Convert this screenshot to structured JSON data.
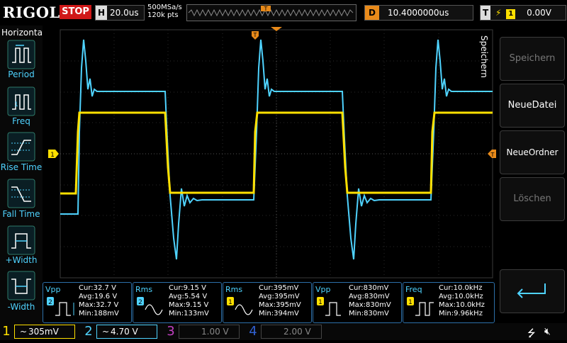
{
  "header": {
    "brand": "RIGOL",
    "run_state": "STOP",
    "timebase_key": "H",
    "timebase": "20.0us",
    "sample_rate": "500MSa/s",
    "memory_depth": "120k pts",
    "delay_key": "D",
    "delay": "10.4000000us",
    "trigger_key": "T",
    "trigger_source": "1",
    "trigger_level": "0.00V"
  },
  "left_menu": {
    "title": "Horizontal",
    "items": [
      {
        "label": "Period"
      },
      {
        "label": "Freq"
      },
      {
        "label": "Rise Time"
      },
      {
        "label": "Fall Time"
      },
      {
        "label": "+Width"
      },
      {
        "label": "-Width"
      }
    ]
  },
  "right_menu": {
    "title": "Speichern",
    "items": [
      {
        "label": "Speichern",
        "enabled": false
      },
      {
        "label": "NeueDatei",
        "enabled": true
      },
      {
        "label": "NeueOrdner",
        "enabled": true
      },
      {
        "label": "Löschen",
        "enabled": false
      }
    ],
    "back_icon": "return-arrow-icon"
  },
  "markers": {
    "trigger_pos": "T",
    "ch1_level": "1",
    "trig_level_arrow": "T"
  },
  "measurements": [
    {
      "name": "Vpp",
      "channel": "2",
      "cur": "Cur:32.7 V",
      "avg": "Avg:19.6 V",
      "max": "Max:32.7 V",
      "min": "Min:188mV"
    },
    {
      "name": "Rms",
      "channel": "2",
      "cur": "Cur:9.15 V",
      "avg": "Avg:5.54 V",
      "max": "Max:9.15 V",
      "min": "Min:133mV"
    },
    {
      "name": "Rms",
      "channel": "1",
      "cur": "Cur:395mV",
      "avg": "Avg:395mV",
      "max": "Max:395mV",
      "min": "Min:394mV"
    },
    {
      "name": "Vpp",
      "channel": "1",
      "cur": "Cur:830mV",
      "avg": "Avg:830mV",
      "max": "Max:830mV",
      "min": "Min:830mV"
    },
    {
      "name": "Freq",
      "channel": "1",
      "cur": "Cur:10.0kHz",
      "avg": "Avg:10.0kHz",
      "max": "Max:10.0kHz",
      "min": "Min:9.96kHz"
    }
  ],
  "channels": [
    {
      "num": "1",
      "coupling": "~",
      "scale": "305mV",
      "color": "#ffe000"
    },
    {
      "num": "2",
      "coupling": "~",
      "scale": "4.70 V",
      "color": "#4fd3ff"
    },
    {
      "num": "3",
      "coupling": "",
      "scale": "1.00 V",
      "color": "#c040c0"
    },
    {
      "num": "4",
      "coupling": "",
      "scale": "2.00 V",
      "color": "#3060d0"
    }
  ],
  "colors": {
    "ch1": "#ffe000",
    "ch2": "#4fd3ff",
    "trigger": "#e88a1a",
    "stop": "#d01818"
  }
}
